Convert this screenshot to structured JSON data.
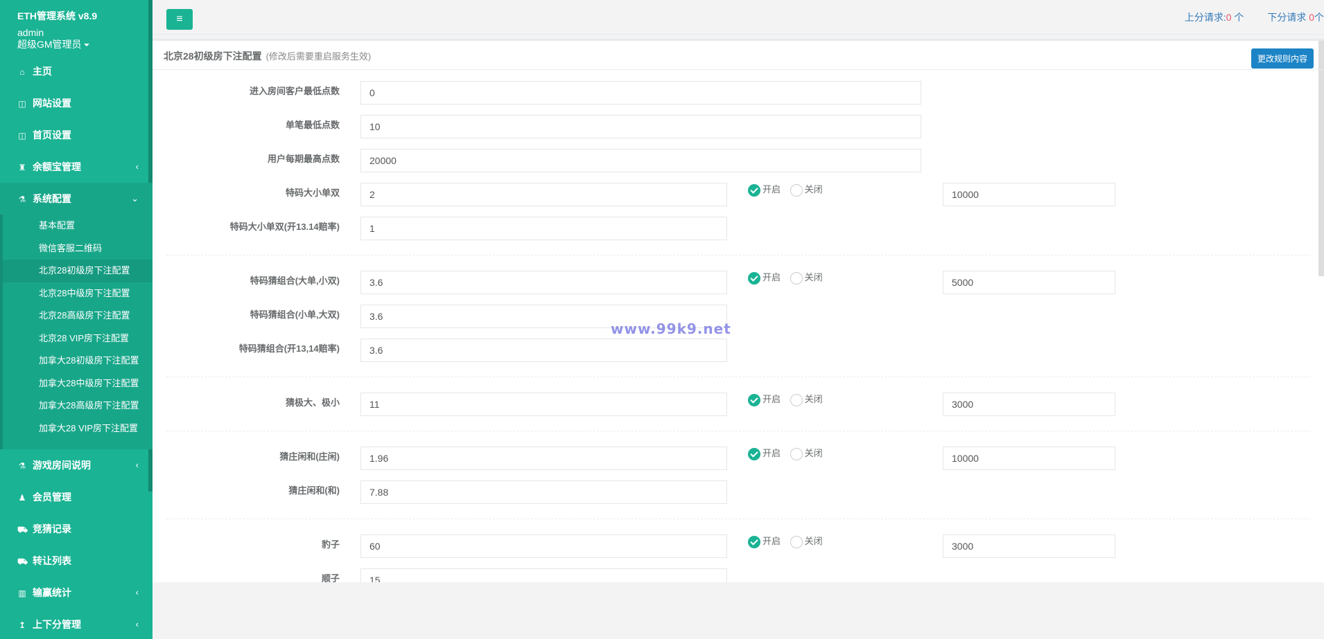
{
  "brand": {
    "app_name": "ETH管理系统 v8.9",
    "user": "admin",
    "role": "超级GM管理员"
  },
  "nav": [
    {
      "label": "主页",
      "icon": "home-icon"
    },
    {
      "label": "网站设置",
      "icon": "columns-icon"
    },
    {
      "label": "首页设置",
      "icon": "columns-icon"
    },
    {
      "label": "余额宝管理",
      "icon": "user-tie-icon"
    },
    {
      "label": "系统配置",
      "icon": "flask-icon"
    },
    {
      "label": "游戏房间说明",
      "icon": "flask-icon"
    },
    {
      "label": "会员管理",
      "icon": "user-icon"
    },
    {
      "label": "竞猜记录",
      "icon": "car-icon"
    },
    {
      "label": "转让列表",
      "icon": "car-icon"
    },
    {
      "label": "输赢统计",
      "icon": "bar-chart-icon"
    },
    {
      "label": "上下分管理",
      "icon": "level-up-icon"
    }
  ],
  "submenu": [
    "基本配置",
    "微信客服二维码",
    "北京28初级房下注配置",
    "北京28中级房下注配置",
    "北京28高级房下注配置",
    "北京28 VIP房下注配置",
    "加拿大28初级房下注配置",
    "加拿大28中级房下注配置",
    "加拿大28高级房下注配置",
    "加拿大28 VIP房下注配置"
  ],
  "topbar": {
    "up_label": "上分请求:",
    "up_count": "0",
    "down_label": "下分请求",
    "down_count": "0",
    "unit": "个"
  },
  "panel": {
    "title": "北京28初级房下注配置",
    "note": "(修改后需要重启服务生效)",
    "change_button": "更改规则内容"
  },
  "radio": {
    "on": "开启",
    "off": "关闭"
  },
  "fields": {
    "min_entry": {
      "label": "进入房间客户最低点数",
      "value": "0"
    },
    "min_single": {
      "label": "单笔最低点数",
      "value": "10"
    },
    "max_period": {
      "label": "用户每期最高点数",
      "value": "20000"
    },
    "dxds": {
      "label": "特码大小单双",
      "value": "2",
      "limit": "10000"
    },
    "dxds_1314": {
      "label": "特码大小单双(开13.14赔率)",
      "value": "1"
    },
    "combo_a": {
      "label": "特码猜组合(大单,小双)",
      "value": "3.6",
      "limit": "5000"
    },
    "combo_b": {
      "label": "特码猜组合(小单,大双)",
      "value": "3.6"
    },
    "combo_1314": {
      "label": "特码猜组合(开13,14赔率)",
      "value": "3.6"
    },
    "extreme": {
      "label": "猜极大、极小",
      "value": "11",
      "limit": "3000"
    },
    "zxh": {
      "label": "猜庄闲和(庄闲)",
      "value": "1.96",
      "limit": "10000"
    },
    "he": {
      "label": "猜庄闲和(和)",
      "value": "7.88"
    },
    "baozi": {
      "label": "豹子",
      "value": "60",
      "limit": "3000"
    },
    "shunzi": {
      "label": "顺子",
      "value": "15"
    }
  },
  "watermark": "www.99k9.net"
}
